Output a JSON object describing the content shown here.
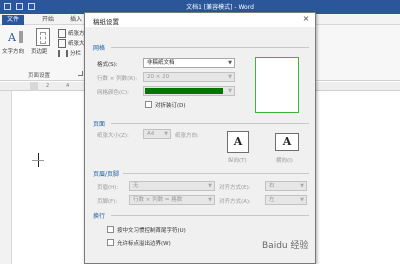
{
  "word": {
    "title": "文档1 [兼容模式] - Word",
    "tabs": [
      "文件",
      "开始",
      "插入"
    ],
    "ribbon": {
      "text_direction": "文字方向",
      "page_margins": "页边距",
      "group_page_setup": "页面设置",
      "paper_direction": "纸张方",
      "paper_size": "纸张大",
      "columns": "分栏"
    },
    "ruler_marks": [
      "2",
      "4"
    ]
  },
  "dialog": {
    "title": "稿纸设置",
    "close_label": "×",
    "grid_section": "网格",
    "format_label": "格式(S):",
    "format_value": "非稿纸文档",
    "rows_cols_label": "行数 × 列数(R):",
    "rows_cols_value": "20 × 20",
    "grid_color_label": "网格颜色(C):",
    "grid_color": "#007700",
    "fold_label": "对折装订(D)",
    "page_section": "页面",
    "paper_size_label": "纸张大小(Z):",
    "paper_size_value": "A4",
    "orientation_label": "纸张方向:",
    "portrait_label": "纵向(T)",
    "landscape_label": "横向(I)",
    "portrait_glyph": "A",
    "landscape_glyph": "A",
    "header_footer_section": "页眉/页脚",
    "header_label": "页眉(H):",
    "header_value": "无",
    "header_align_label": "对齐方式(E):",
    "header_align_value": "右",
    "footer_label": "页脚(F):",
    "footer_value": "行数 × 列数 = 格数",
    "footer_align_label": "对齐方式(A):",
    "footer_align_value": "左",
    "wrap_section": "换行",
    "option1": "按中文习惯控制首尾字符(U)",
    "option2": "允许标点溢出边界(W)",
    "watermark": "Baidu 经验"
  }
}
